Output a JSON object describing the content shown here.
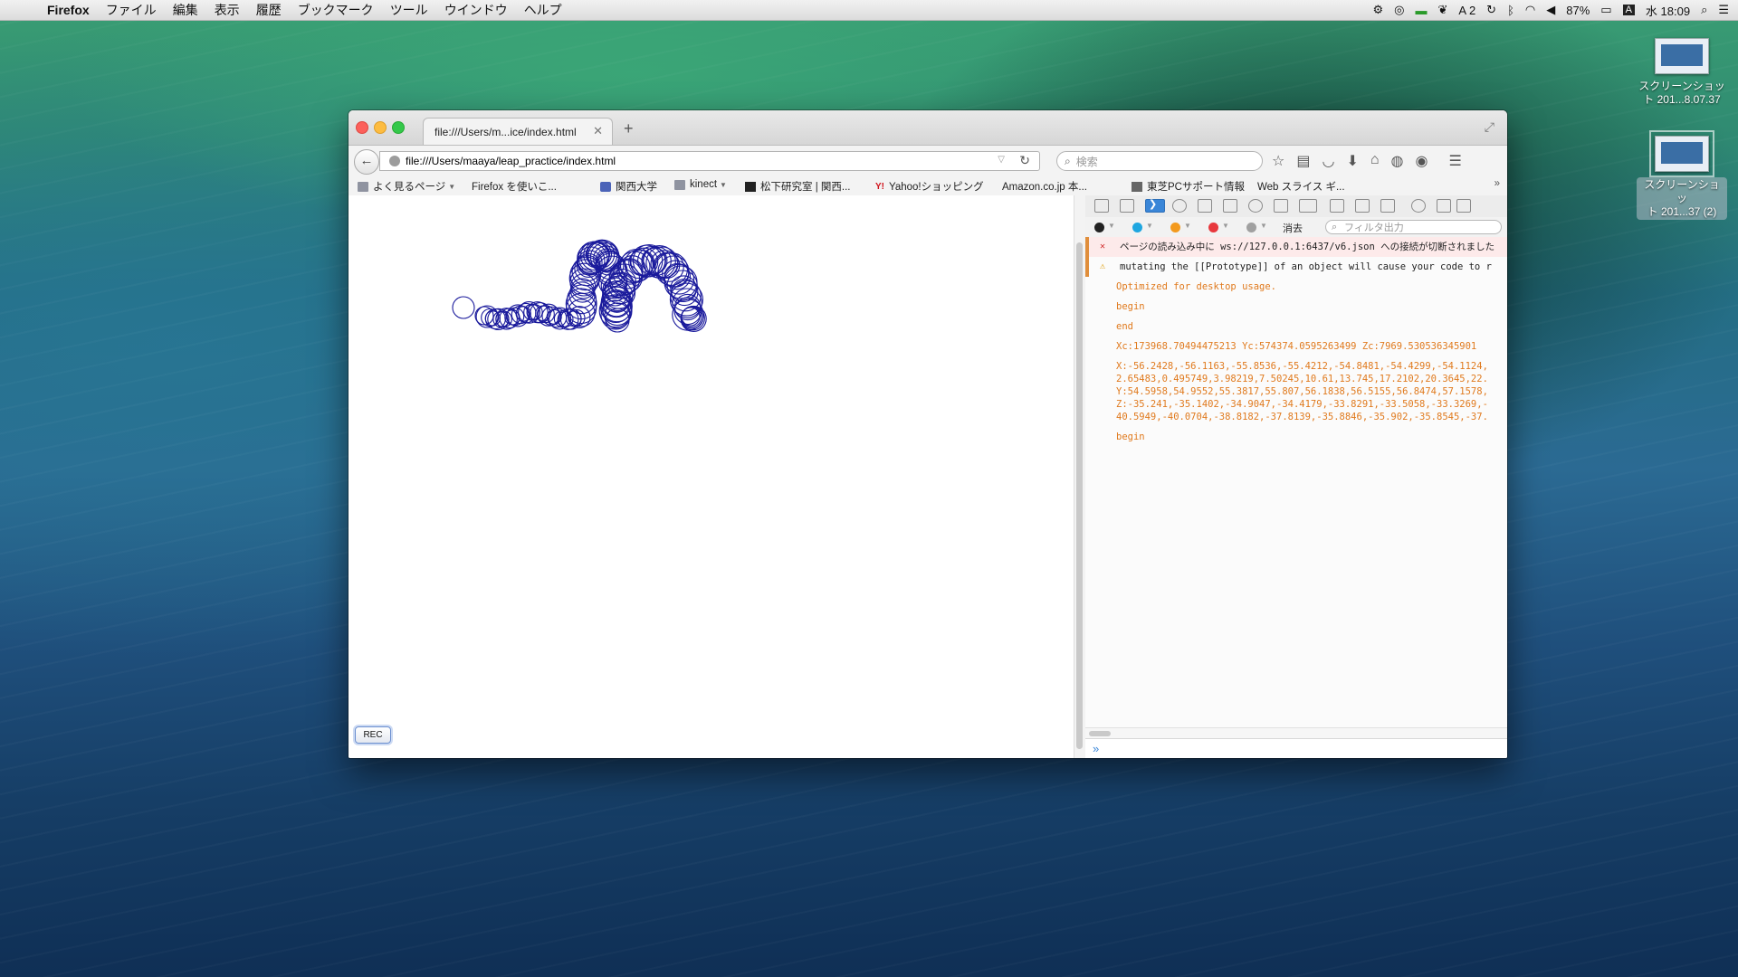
{
  "menubar": {
    "items": [
      "Firefox",
      "ファイル",
      "編集",
      "表示",
      "履歴",
      "ブックマーク",
      "ツール",
      "ウインドウ",
      "ヘルプ"
    ],
    "status": {
      "input_mode": "A 2",
      "battery": "87%",
      "keyboard": "A",
      "clock": "水 18:09"
    }
  },
  "desktop": {
    "icons": [
      {
        "label_line1": "スクリーンショッ",
        "label_line2": "ト 201...8.07.37"
      },
      {
        "label_line1": "スクリーンショッ",
        "label_line2": "ト 201...37 (2)"
      }
    ]
  },
  "browser": {
    "tab_title": "file:///Users/m...ice/index.html",
    "url": "file:///Users/maaya/leap_practice/index.html",
    "search_placeholder": "検索",
    "bookmarks": [
      {
        "label": "よく見るページ",
        "icon": "folder-icon"
      },
      {
        "label": "Firefox を使いこ...",
        "icon": "page-icon"
      },
      {
        "label": "関西大学",
        "icon": "university-icon"
      },
      {
        "label": "kinect",
        "icon": "folder-icon"
      },
      {
        "label": "松下研究室 | 関西...",
        "icon": "lab-icon"
      },
      {
        "label": "Yahoo!ショッピング",
        "icon": "yahoo-icon"
      },
      {
        "label": "Amazon.co.jp 本...",
        "icon": "page-icon"
      },
      {
        "label": "東芝PCサポート情報",
        "icon": "toshiba-icon"
      },
      {
        "label": "Web スライス ギ...",
        "icon": "page-icon"
      }
    ]
  },
  "page": {
    "rec_button": "REC",
    "circle_color": "#1a1a9c"
  },
  "devtools": {
    "clear_label": "消去",
    "filter_placeholder": "フィルタ出力",
    "filter_dot_colors": [
      "#222222",
      "#1ea6e0",
      "#f39a1e",
      "#e8383d",
      "#a0a0a0"
    ],
    "console": {
      "error": "ページの読み込み中に ws://127.0.0.1:6437/v6.json への接続が切断されました",
      "warning": "mutating the [[Prototype]] of an object will cause your code to r",
      "info1": "Optimized for desktop usage.",
      "info2": "begin",
      "info3": "end",
      "xyz": "Xc:173968.70494475213 Yc:574374.0595263499 Zc:7969.530536345901",
      "data_lines": [
        "X:-56.2428,-56.1163,-55.8536,-55.4212,-54.8481,-54.4299,-54.1124,",
        "2.65483,0.495749,3.98219,7.50245,10.61,13.745,17.2102,20.3645,22.",
        "Y:54.5958,54.9552,55.3817,55.807,56.1838,56.5155,56.8474,57.1578,",
        "Z:-35.241,-35.1402,-34.9047,-34.4179,-33.8291,-33.5058,-33.3269,-",
        "40.5949,-40.0704,-38.8182,-37.8139,-35.8846,-35.902,-35.8545,-37."
      ],
      "info4": "begin"
    }
  }
}
